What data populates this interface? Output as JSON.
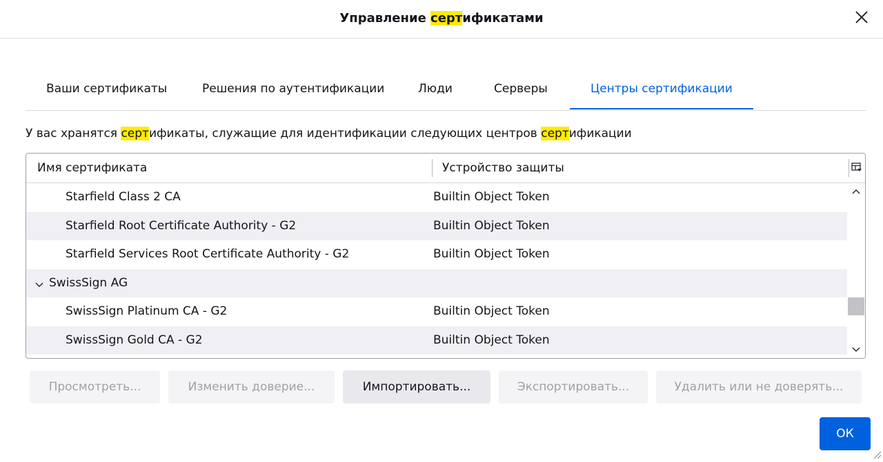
{
  "dialog": {
    "title_parts": [
      "Управление ",
      "серт",
      "ификатами"
    ]
  },
  "tabs": [
    {
      "label": "Ваши сертификаты",
      "active": false
    },
    {
      "label": "Решения по аутентификации",
      "active": false
    },
    {
      "label": "Люди",
      "active": false
    },
    {
      "label": "Серверы",
      "active": false
    },
    {
      "label": "Центры сертификации",
      "active": true
    }
  ],
  "description_parts": [
    "У вас хранятся ",
    "серт",
    "ификаты, служащие для идентификации следующих центров ",
    "серт",
    "ификации"
  ],
  "table": {
    "columns": [
      "Имя сертификата",
      "Устройство защиты"
    ],
    "rows": [
      {
        "name": "Starfield Class 2 CA",
        "device": "Builtin Object Token",
        "group": false
      },
      {
        "name": "Starfield Root Certificate Authority - G2",
        "device": "Builtin Object Token",
        "group": false
      },
      {
        "name": "Starfield Services Root Certificate Authority - G2",
        "device": "Builtin Object Token",
        "group": false
      },
      {
        "name": "SwissSign AG",
        "device": "",
        "group": true
      },
      {
        "name": "SwissSign Platinum CA - G2",
        "device": "Builtin Object Token",
        "group": false
      },
      {
        "name": "SwissSign Gold CA - G2",
        "device": "Builtin Object Token",
        "group": false
      }
    ]
  },
  "buttons": {
    "view": "Просмотреть...",
    "edit_trust": "Изменить доверие...",
    "import": "Импортировать...",
    "export": "Экспортировать...",
    "delete": "Удалить или не доверять...",
    "ok": "ОК"
  },
  "colors": {
    "accent": "#0061e0",
    "highlight": "#ffea00"
  },
  "icons": [
    "close-icon",
    "column-picker-icon",
    "chevron-down-icon",
    "scroll-up-icon",
    "scroll-down-icon",
    "resize-grip-icon"
  ]
}
